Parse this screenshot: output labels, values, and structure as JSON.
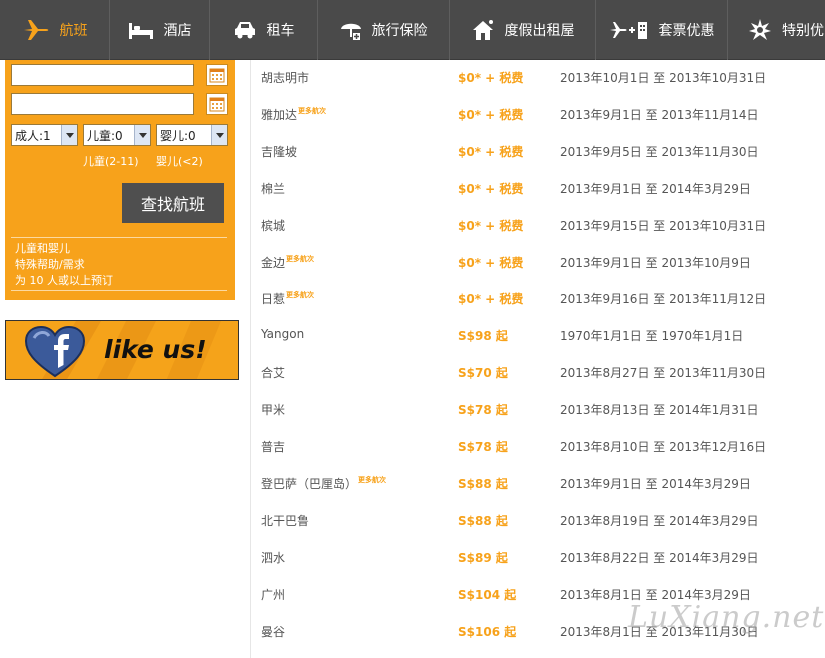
{
  "nav": {
    "items": [
      {
        "label": "航班",
        "icon": "airplane-icon"
      },
      {
        "label": "酒店",
        "icon": "bed-icon"
      },
      {
        "label": "租车",
        "icon": "car-icon"
      },
      {
        "label": "旅行保险",
        "icon": "umbrella-icon"
      },
      {
        "label": "度假出租屋",
        "icon": "house-icon"
      },
      {
        "label": "套票优惠",
        "icon": "flight-hotel-icon"
      },
      {
        "label": "特别优",
        "icon": "starburst-icon"
      }
    ]
  },
  "search": {
    "from_value": "",
    "to_value": "",
    "adults": "成人:1",
    "children": "儿童:0",
    "infants": "婴儿:0",
    "children_hint": "儿童(2-11)",
    "infants_hint": "婴儿(<2)",
    "find_label": "查找航班",
    "help_links": [
      "儿童和婴儿",
      "特殊帮助/需求",
      "为 10 人或以上预订"
    ]
  },
  "facebook": {
    "text": "like us!"
  },
  "fares": [
    {
      "city": "胡志明市",
      "tag": "",
      "price": "$0* + 税费",
      "dates": "2013年10月1日 至 2013年10月31日"
    },
    {
      "city": "雅加达",
      "tag": "更多航次",
      "price": "$0* + 税费",
      "dates": "2013年9月1日 至 2013年11月14日"
    },
    {
      "city": "吉隆坡",
      "tag": "",
      "price": "$0* + 税费",
      "dates": "2013年9月5日 至 2013年11月30日"
    },
    {
      "city": "棉兰",
      "tag": "",
      "price": "$0* + 税费",
      "dates": "2013年9月1日 至 2014年3月29日"
    },
    {
      "city": "槟城",
      "tag": "",
      "price": "$0* + 税费",
      "dates": "2013年9月15日 至 2013年10月31日"
    },
    {
      "city": "金边",
      "tag": "更多航次",
      "price": "$0* + 税费",
      "dates": "2013年9月1日 至 2013年10月9日"
    },
    {
      "city": "日惹",
      "tag": "更多航次",
      "price": "$0* + 税费",
      "dates": "2013年9月16日 至 2013年11月12日"
    },
    {
      "city": "Yangon",
      "tag": "",
      "price": "S$98 起",
      "dates": "1970年1月1日 至 1970年1月1日"
    },
    {
      "city": "合艾",
      "tag": "",
      "price": "S$70 起",
      "dates": "2013年8月27日 至 2013年11月30日"
    },
    {
      "city": "甲米",
      "tag": "",
      "price": "S$78 起",
      "dates": "2013年8月13日 至 2014年1月31日"
    },
    {
      "city": "普吉",
      "tag": "",
      "price": "S$78 起",
      "dates": "2013年8月10日 至 2013年12月16日"
    },
    {
      "city": "登巴萨（巴厘岛）",
      "tag": "更多航次",
      "price": "S$88 起",
      "dates": "2013年9月1日 至 2014年3月29日"
    },
    {
      "city": "北干巴鲁",
      "tag": "",
      "price": "S$88 起",
      "dates": "2013年8月19日 至 2014年3月29日"
    },
    {
      "city": "泗水",
      "tag": "",
      "price": "S$89 起",
      "dates": "2013年8月22日 至 2014年3月29日"
    },
    {
      "city": "广州",
      "tag": "",
      "price": "S$104 起",
      "dates": "2013年8月1日 至 2014年3月29日"
    },
    {
      "city": "曼谷",
      "tag": "",
      "price": "S$106 起",
      "dates": "2013年8月1日 至 2013年11月30日"
    }
  ],
  "watermark": "LuXiang.net",
  "colors": {
    "accent": "#f7a21b",
    "nav_bg": "#4a4a4a",
    "button_bg": "#4f4f4f"
  }
}
